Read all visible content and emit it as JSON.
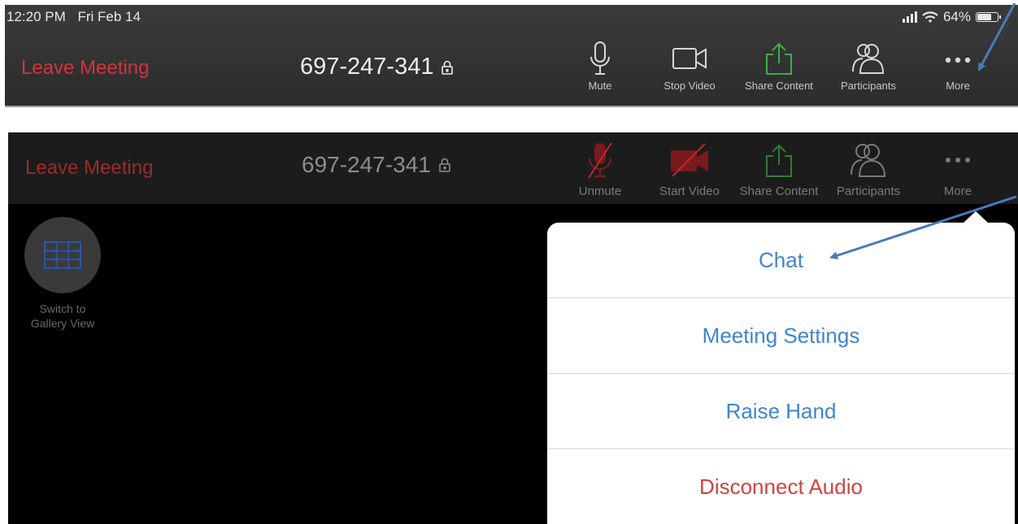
{
  "top_screenshot": {
    "status_bar": {
      "time": "12:20 PM",
      "date": "Fri Feb 14",
      "battery": "64%"
    },
    "leave_label": "Leave Meeting",
    "meeting_id": "697-247-341",
    "toolbar": [
      {
        "label": "Mute",
        "icon": "microphone-icon"
      },
      {
        "label": "Stop Video",
        "icon": "video-camera-icon"
      },
      {
        "label": "Share Content",
        "icon": "share-icon"
      },
      {
        "label": "Participants",
        "icon": "participants-icon"
      },
      {
        "label": "More",
        "icon": "more-dots-icon"
      }
    ]
  },
  "second_screenshot": {
    "leave_label": "Leave Meeting",
    "meeting_id": "697-247-341",
    "toolbar": [
      {
        "label": "Unmute",
        "icon": "microphone-muted-icon"
      },
      {
        "label": "Start Video",
        "icon": "video-camera-off-icon"
      },
      {
        "label": "Share Content",
        "icon": "share-icon"
      },
      {
        "label": "Participants",
        "icon": "participants-icon"
      },
      {
        "label": "More",
        "icon": "more-dots-icon"
      }
    ],
    "gallery_button": {
      "line1": "Switch to",
      "line2": "Gallery View",
      "icon": "grid-icon"
    },
    "more_menu": [
      {
        "label": "Chat"
      },
      {
        "label": "Meeting Settings"
      },
      {
        "label": "Raise Hand"
      },
      {
        "label": "Disconnect Audio"
      }
    ]
  },
  "colors": {
    "leave_red": "#d4343a",
    "menu_blue": "#3d86cf",
    "menu_danger": "#d0433f",
    "share_green": "#3fae49",
    "muted_red": "#c0272d",
    "annotation_arrow": "#4a7ab8"
  }
}
